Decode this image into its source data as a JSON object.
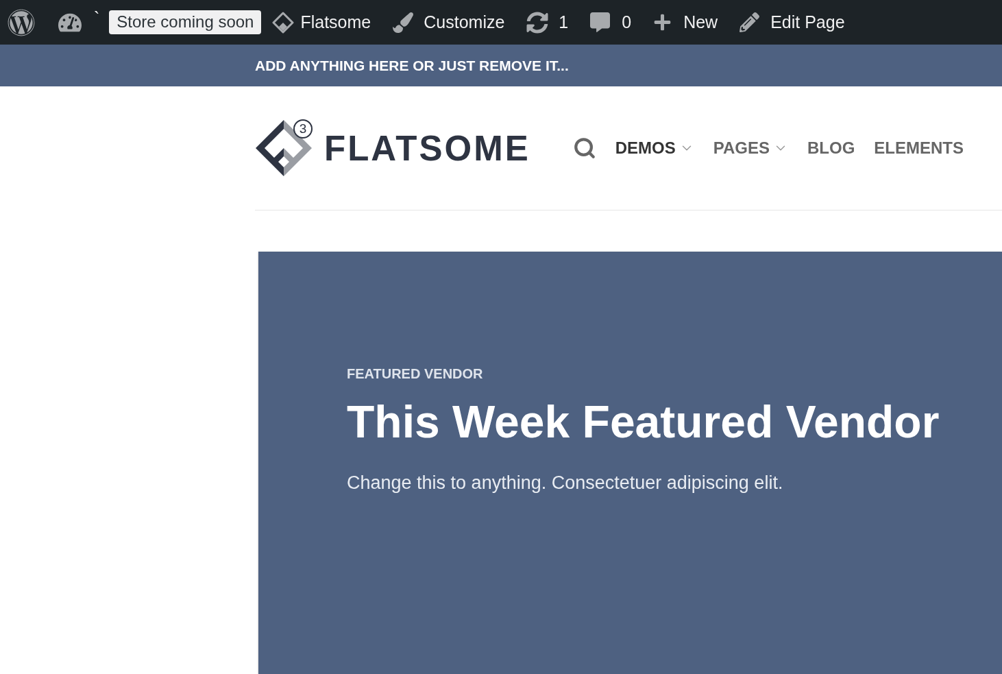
{
  "admin_bar": {
    "mark": "`",
    "store_notice": "Store coming soon",
    "items": [
      {
        "kind": "site",
        "label": "Flatsome"
      },
      {
        "kind": "customize",
        "label": "Customize"
      },
      {
        "kind": "updates",
        "label": "1"
      },
      {
        "kind": "comments",
        "label": "0"
      },
      {
        "kind": "new",
        "label": "New"
      },
      {
        "kind": "edit",
        "label": "Edit Page"
      }
    ]
  },
  "top_bar": {
    "text": "ADD ANYTHING HERE OR JUST REMOVE IT..."
  },
  "header": {
    "logo": {
      "name": "FLATSOME",
      "badge": "3"
    },
    "nav": [
      {
        "label": "DEMOS",
        "selected": true,
        "dropdown": true
      },
      {
        "label": "PAGES",
        "selected": false,
        "dropdown": true
      },
      {
        "label": "BLOG",
        "selected": false,
        "dropdown": false
      },
      {
        "label": "ELEMENTS",
        "selected": false,
        "dropdown": false
      }
    ]
  },
  "hero": {
    "eyebrow": "FEATURED VENDOR",
    "title": "This Week Featured Vendor",
    "subtitle": "Change this to anything. Consectetuer adipiscing elit."
  }
}
